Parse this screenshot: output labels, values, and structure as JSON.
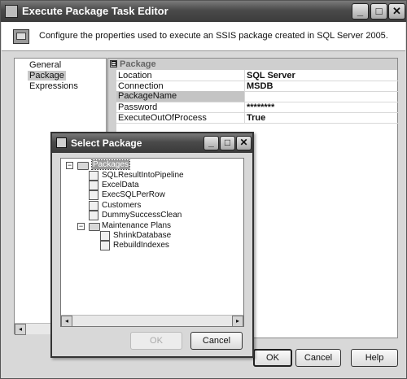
{
  "window": {
    "title": "Execute Package Task Editor"
  },
  "title_buttons": {
    "minimize": "_",
    "maximize": "□",
    "close": "✕"
  },
  "header": {
    "description": "Configure the properties used to execute an SSIS package created in SQL Server 2005."
  },
  "nav": {
    "items": [
      "General",
      "Package",
      "Expressions"
    ],
    "selected": "Package"
  },
  "property_grid": {
    "category": "Package",
    "expander": "⊟",
    "rows": [
      {
        "name": "Location",
        "value": "SQL Server"
      },
      {
        "name": "Connection",
        "value": "MSDB"
      },
      {
        "name": "PackageName",
        "value": ""
      },
      {
        "name": "Password",
        "value": "********"
      },
      {
        "name": "ExecuteOutOfProcess",
        "value": "True"
      }
    ],
    "selected_row": "PackageName"
  },
  "main_buttons": {
    "ok": "OK",
    "cancel": "Cancel",
    "help": "Help"
  },
  "dialog": {
    "title": "Select Package",
    "tree": {
      "root": "Packages",
      "children": [
        "SQLResultIntoPipeline",
        "ExcelData",
        "ExecSQLPerRow",
        "Customers",
        "DummySuccessClean"
      ],
      "folder": "Maintenance Plans",
      "folder_children": [
        "ShrinkDatabase",
        "RebuildIndexes"
      ]
    },
    "buttons": {
      "ok": "OK",
      "cancel": "Cancel"
    }
  }
}
